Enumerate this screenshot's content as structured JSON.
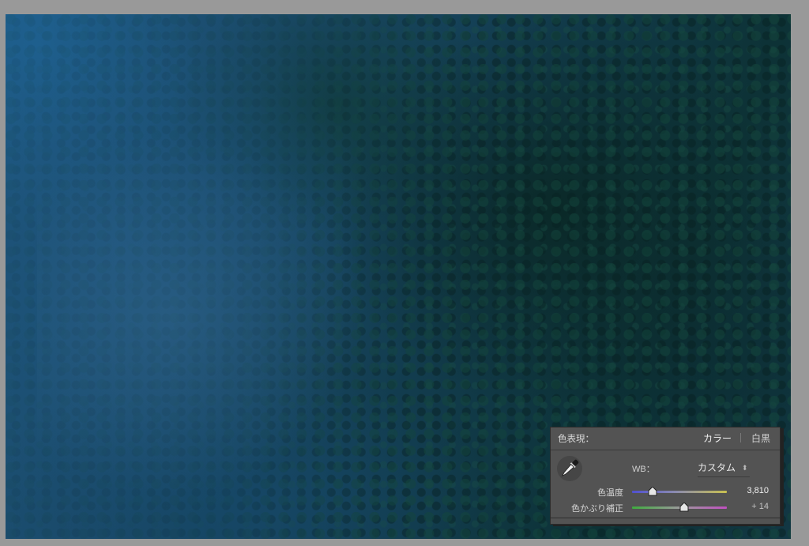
{
  "photo": {
    "description_icon": "image-canvas"
  },
  "treatment": {
    "label": "色表現：",
    "color_option": "カラー",
    "bw_option": "白黒",
    "selected": "カラー"
  },
  "white_balance": {
    "label": "WB：",
    "value": "カスタム",
    "picker_icon": "eyedropper-icon",
    "select_icon": "up-down-arrows-icon"
  },
  "sliders": {
    "temp": {
      "label": "色温度",
      "value_text": "3,810",
      "value": 3810,
      "min": 2000,
      "max": 50000,
      "fraction": 0.22
    },
    "tint": {
      "label": "色かぶり補正",
      "value_text": "+ 14",
      "value": 14,
      "min": -150,
      "max": 150,
      "fraction": 0.55
    }
  },
  "colors": {
    "panel_bg": "#535353",
    "temp_track_start": "#5050d0",
    "temp_track_end": "#c8c050",
    "tint_track_start": "#3faa3f",
    "tint_track_end": "#c050c0"
  }
}
